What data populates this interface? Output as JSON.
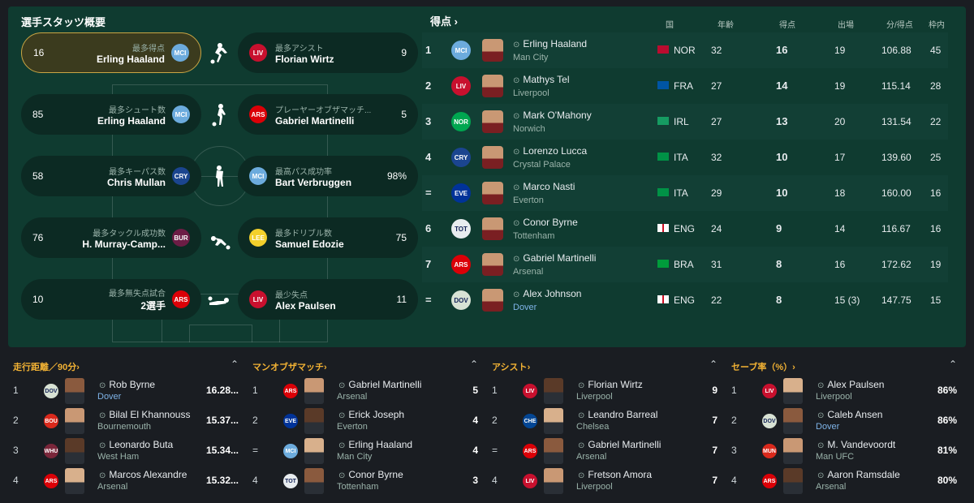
{
  "summary": {
    "title": "選手スタッツ概要",
    "cards": [
      {
        "left": {
          "value": "16",
          "label": "最多得点",
          "name": "Erling Haaland",
          "club_abbr": "MCI",
          "club_color": "#6cabdd"
        },
        "right": {
          "value": "9",
          "label": "最多アシスト",
          "name": "Florian Wirtz",
          "club_abbr": "LIV",
          "club_color": "#c8102e"
        }
      },
      {
        "left": {
          "value": "85",
          "label": "最多シュート数",
          "name": "Erling Haaland",
          "club_abbr": "MCI",
          "club_color": "#6cabdd"
        },
        "right": {
          "value": "5",
          "label": "プレーヤーオブザマッチ...",
          "name": "Gabriel Martinelli",
          "club_abbr": "ARS",
          "club_color": "#db0007"
        }
      },
      {
        "left": {
          "value": "58",
          "label": "最多キーパス数",
          "name": "Chris Mullan",
          "club_abbr": "CRY",
          "club_color": "#1b458f"
        },
        "right": {
          "value": "98%",
          "label": "最高パス成功率",
          "name": "Bart Verbruggen",
          "club_abbr": "MCI",
          "club_color": "#6cabdd"
        }
      },
      {
        "left": {
          "value": "76",
          "label": "最多タックル成功数",
          "name": "H. Murray-Camp...",
          "club_abbr": "BUR",
          "club_color": "#6c1d45"
        },
        "right": {
          "value": "75",
          "label": "最多ドリブル数",
          "name": "Samuel Edozie",
          "club_abbr": "LEE",
          "club_color": "#f3d02b"
        }
      },
      {
        "left": {
          "value": "10",
          "label": "最多無失点試合",
          "name": "2選手",
          "club_abbr": "ARS",
          "club_color": "#db0007"
        },
        "right": {
          "value": "11",
          "label": "最少失点",
          "name": "Alex Paulsen",
          "club_abbr": "LIV",
          "club_color": "#c8102e"
        }
      }
    ]
  },
  "scorers": {
    "title": "得点",
    "headers": {
      "nation": "国",
      "age": "年齢",
      "goals": "得点",
      "apps": "出場",
      "mins_per_goal": "分/得点",
      "on_target": "枠内"
    },
    "rows": [
      {
        "rank": "1",
        "club_abbr": "MCI",
        "club_color": "#6cabdd",
        "name": "Erling Haaland",
        "club": "Man City",
        "nat": "NOR",
        "flag": "#ba0c2f",
        "age": "32",
        "goals": "16",
        "apps": "19",
        "mpg": "106.88",
        "sot": "45"
      },
      {
        "rank": "2",
        "club_abbr": "LIV",
        "club_color": "#c8102e",
        "name": "Mathys Tel",
        "club": "Liverpool",
        "nat": "FRA",
        "flag": "#0055a4",
        "age": "27",
        "goals": "14",
        "apps": "19",
        "mpg": "115.14",
        "sot": "28"
      },
      {
        "rank": "3",
        "club_abbr": "NOR",
        "club_color": "#00a650",
        "name": "Mark O'Mahony",
        "club": "Norwich",
        "nat": "IRL",
        "flag": "#169b62",
        "age": "27",
        "goals": "13",
        "apps": "20",
        "mpg": "131.54",
        "sot": "22"
      },
      {
        "rank": "4",
        "club_abbr": "CRY",
        "club_color": "#1b458f",
        "name": "Lorenzo Lucca",
        "club": "Crystal Palace",
        "nat": "ITA",
        "flag": "#009246",
        "age": "32",
        "goals": "10",
        "apps": "17",
        "mpg": "139.60",
        "sot": "25"
      },
      {
        "rank": "=",
        "club_abbr": "EVE",
        "club_color": "#003399",
        "name": "Marco Nasti",
        "club": "Everton",
        "nat": "ITA",
        "flag": "#009246",
        "age": "29",
        "goals": "10",
        "apps": "18",
        "mpg": "160.00",
        "sot": "16"
      },
      {
        "rank": "6",
        "club_abbr": "TOT",
        "club_color": "#e8ecef",
        "name": "Conor Byrne",
        "club": "Tottenham",
        "nat": "ENG",
        "flag": "#ffffff",
        "age": "24",
        "goals": "9",
        "apps": "14",
        "mpg": "116.67",
        "sot": "16"
      },
      {
        "rank": "7",
        "club_abbr": "ARS",
        "club_color": "#db0007",
        "name": "Gabriel Martinelli",
        "club": "Arsenal",
        "nat": "BRA",
        "flag": "#009c3b",
        "age": "31",
        "goals": "8",
        "apps": "16",
        "mpg": "172.62",
        "sot": "19"
      },
      {
        "rank": "=",
        "club_abbr": "DOV",
        "club_color": "#d8e2d4",
        "name": "Alex Johnson",
        "club": "Dover",
        "nat": "ENG",
        "flag": "#ffffff",
        "age": "22",
        "goals": "8",
        "apps": "15 (3)",
        "mpg": "147.75",
        "sot": "15"
      }
    ]
  },
  "panels": [
    {
      "title": "走行距離／90分",
      "rows": [
        {
          "rank": "1",
          "club_abbr": "DOV",
          "club_color": "#d8e2d4",
          "name": "Rob Byrne",
          "club": "Dover",
          "link": true,
          "value": "16.28..."
        },
        {
          "rank": "2",
          "club_abbr": "BOU",
          "club_color": "#da291c",
          "name": "Bilal El Khannouss",
          "club": "Bournemouth",
          "link": false,
          "value": "15.37..."
        },
        {
          "rank": "3",
          "club_abbr": "WHU",
          "club_color": "#7a263a",
          "name": "Leonardo Buta",
          "club": "West Ham",
          "link": false,
          "value": "15.34..."
        },
        {
          "rank": "4",
          "club_abbr": "ARS",
          "club_color": "#db0007",
          "name": "Marcos Alexandre",
          "club": "Arsenal",
          "link": false,
          "value": "15.32..."
        }
      ]
    },
    {
      "title": "マンオブザマッチ",
      "rows": [
        {
          "rank": "1",
          "club_abbr": "ARS",
          "club_color": "#db0007",
          "name": "Gabriel Martinelli",
          "club": "Arsenal",
          "link": false,
          "value": "5"
        },
        {
          "rank": "2",
          "club_abbr": "EVE",
          "club_color": "#003399",
          "name": "Erick Joseph",
          "club": "Everton",
          "link": false,
          "value": "4"
        },
        {
          "rank": "=",
          "club_abbr": "MCI",
          "club_color": "#6cabdd",
          "name": "Erling Haaland",
          "club": "Man City",
          "link": false,
          "value": "4"
        },
        {
          "rank": "4",
          "club_abbr": "TOT",
          "club_color": "#e8ecef",
          "name": "Conor Byrne",
          "club": "Tottenham",
          "link": false,
          "value": "3"
        }
      ]
    },
    {
      "title": "アシスト",
      "rows": [
        {
          "rank": "1",
          "club_abbr": "LIV",
          "club_color": "#c8102e",
          "name": "Florian Wirtz",
          "club": "Liverpool",
          "link": false,
          "value": "9"
        },
        {
          "rank": "2",
          "club_abbr": "CHE",
          "club_color": "#034694",
          "name": "Leandro Barreal",
          "club": "Chelsea",
          "link": false,
          "value": "7"
        },
        {
          "rank": "=",
          "club_abbr": "ARS",
          "club_color": "#db0007",
          "name": "Gabriel Martinelli",
          "club": "Arsenal",
          "link": false,
          "value": "7"
        },
        {
          "rank": "4",
          "club_abbr": "LIV",
          "club_color": "#c8102e",
          "name": "Fretson Amora",
          "club": "Liverpool",
          "link": false,
          "value": "7"
        }
      ]
    },
    {
      "title": "セーブ率（%）",
      "rows": [
        {
          "rank": "1",
          "club_abbr": "LIV",
          "club_color": "#c8102e",
          "name": "Alex Paulsen",
          "club": "Liverpool",
          "link": false,
          "value": "86%"
        },
        {
          "rank": "2",
          "club_abbr": "DOV",
          "club_color": "#d8e2d4",
          "name": "Caleb Ansen",
          "club": "Dover",
          "link": true,
          "value": "86%"
        },
        {
          "rank": "3",
          "club_abbr": "MUN",
          "club_color": "#da291c",
          "name": "M. Vandevoordt",
          "club": "Man UFC",
          "link": false,
          "value": "81%"
        },
        {
          "rank": "4",
          "club_abbr": "ARS",
          "club_color": "#db0007",
          "name": "Aaron Ramsdale",
          "club": "Arsenal",
          "link": false,
          "value": "80%"
        }
      ]
    }
  ]
}
